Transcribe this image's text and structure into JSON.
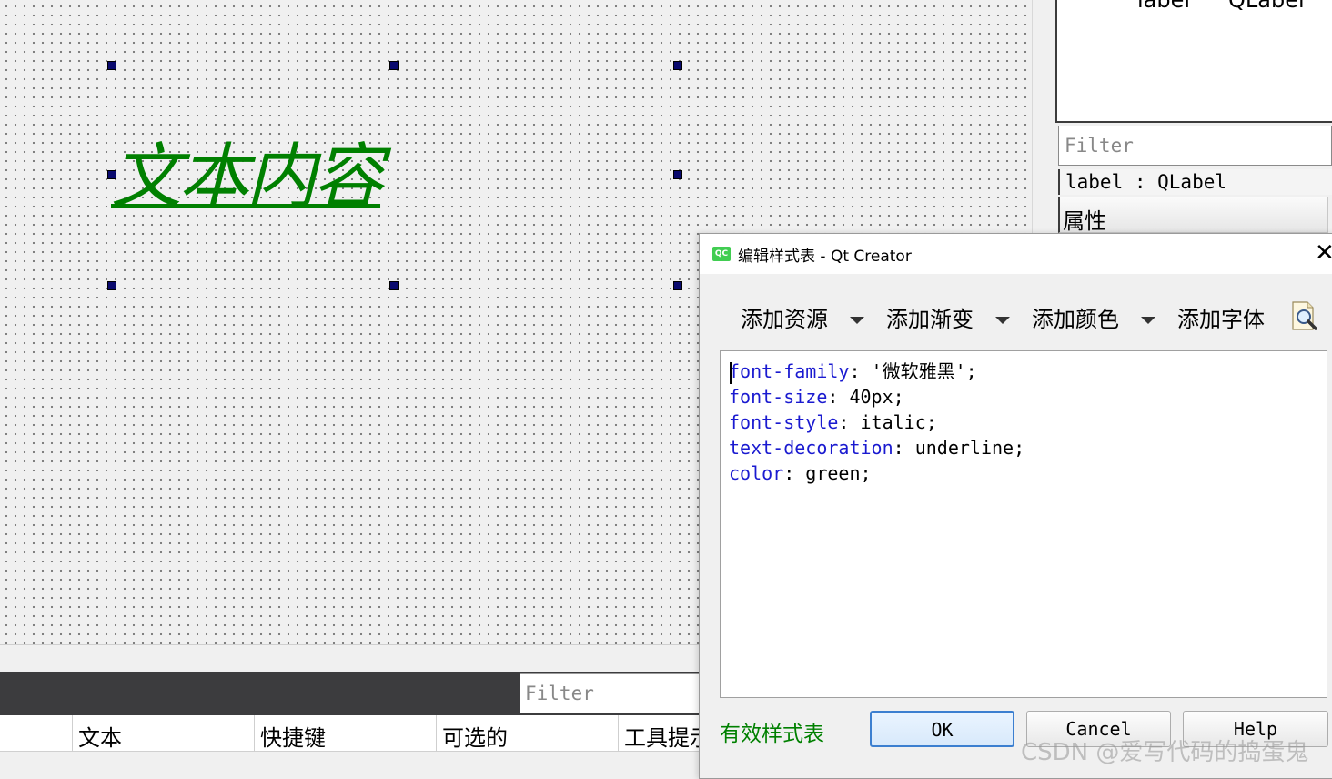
{
  "preview": {
    "label_text": "文本内容"
  },
  "action_editor": {
    "filter_placeholder": "Filter",
    "columns": [
      "文本",
      "快捷键",
      "可选的",
      "工具提示"
    ]
  },
  "object_inspector": {
    "row_object": "label",
    "row_class": "QLabel"
  },
  "property_editor": {
    "filter_placeholder": "Filter",
    "object_label": "label : QLabel",
    "header": "属性"
  },
  "dialog": {
    "app_icon": "QC",
    "title": "编辑样式表 - Qt Creator",
    "close_glyph": "✕",
    "toolbar": {
      "add_resource": "添加资源",
      "add_gradient": "添加渐变",
      "add_color": "添加颜色",
      "add_font": "添加字体"
    },
    "stylesheet": [
      {
        "prop": "font-family",
        "value": ": '微软雅黑';"
      },
      {
        "prop": "font-size",
        "value": ": 40px;"
      },
      {
        "prop": "font-style",
        "value": ": italic;"
      },
      {
        "prop": "text-decoration",
        "value": ": underline;"
      },
      {
        "prop": "color",
        "value": ": green;"
      }
    ],
    "status": "有效样式表",
    "buttons": {
      "ok": "OK",
      "cancel": "Cancel",
      "help": "Help"
    }
  },
  "watermark": "CSDN @爱写代码的捣蛋鬼",
  "colors": {
    "label_green": "#008000",
    "keyword_blue": "#1a1ad0",
    "ok_border": "#3c7fd0"
  },
  "icons": [
    "resize-handle-icon",
    "dropdown-arrow-icon",
    "check-stylesheet-icon",
    "close-icon",
    "qt-creator-app-icon"
  ]
}
